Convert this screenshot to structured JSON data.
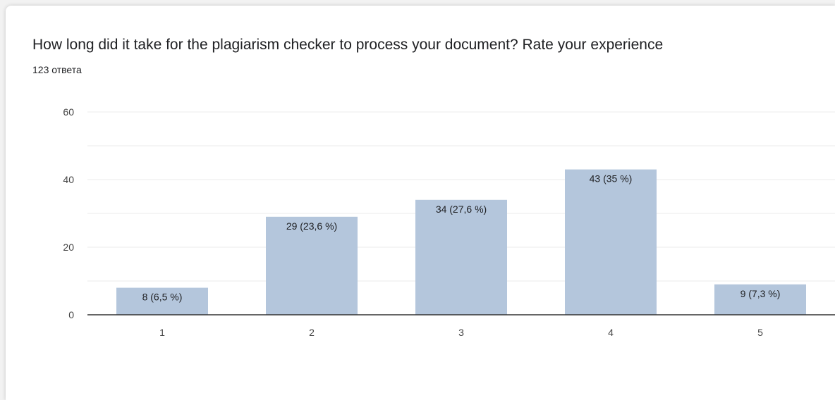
{
  "title": "How long did it take for the plagiarism checker to process your document? Rate your experience",
  "subtitle": "123 ответа",
  "colors": {
    "bar": "#b4c6dc",
    "grid": "#ebebeb",
    "axis": "#333333"
  },
  "chart_data": {
    "type": "bar",
    "categories": [
      "1",
      "2",
      "3",
      "4",
      "5"
    ],
    "values": [
      8,
      29,
      34,
      43,
      9
    ],
    "data_labels": [
      "8 (6,5 %)",
      "29 (23,6 %)",
      "34 (27,6 %)",
      "43 (35 %)",
      "9 (7,3 %)"
    ],
    "ylim": [
      0,
      60
    ],
    "yticks": [
      0,
      20,
      40,
      60
    ],
    "grid": true,
    "legend": "none",
    "xlabel": "",
    "ylabel": ""
  }
}
